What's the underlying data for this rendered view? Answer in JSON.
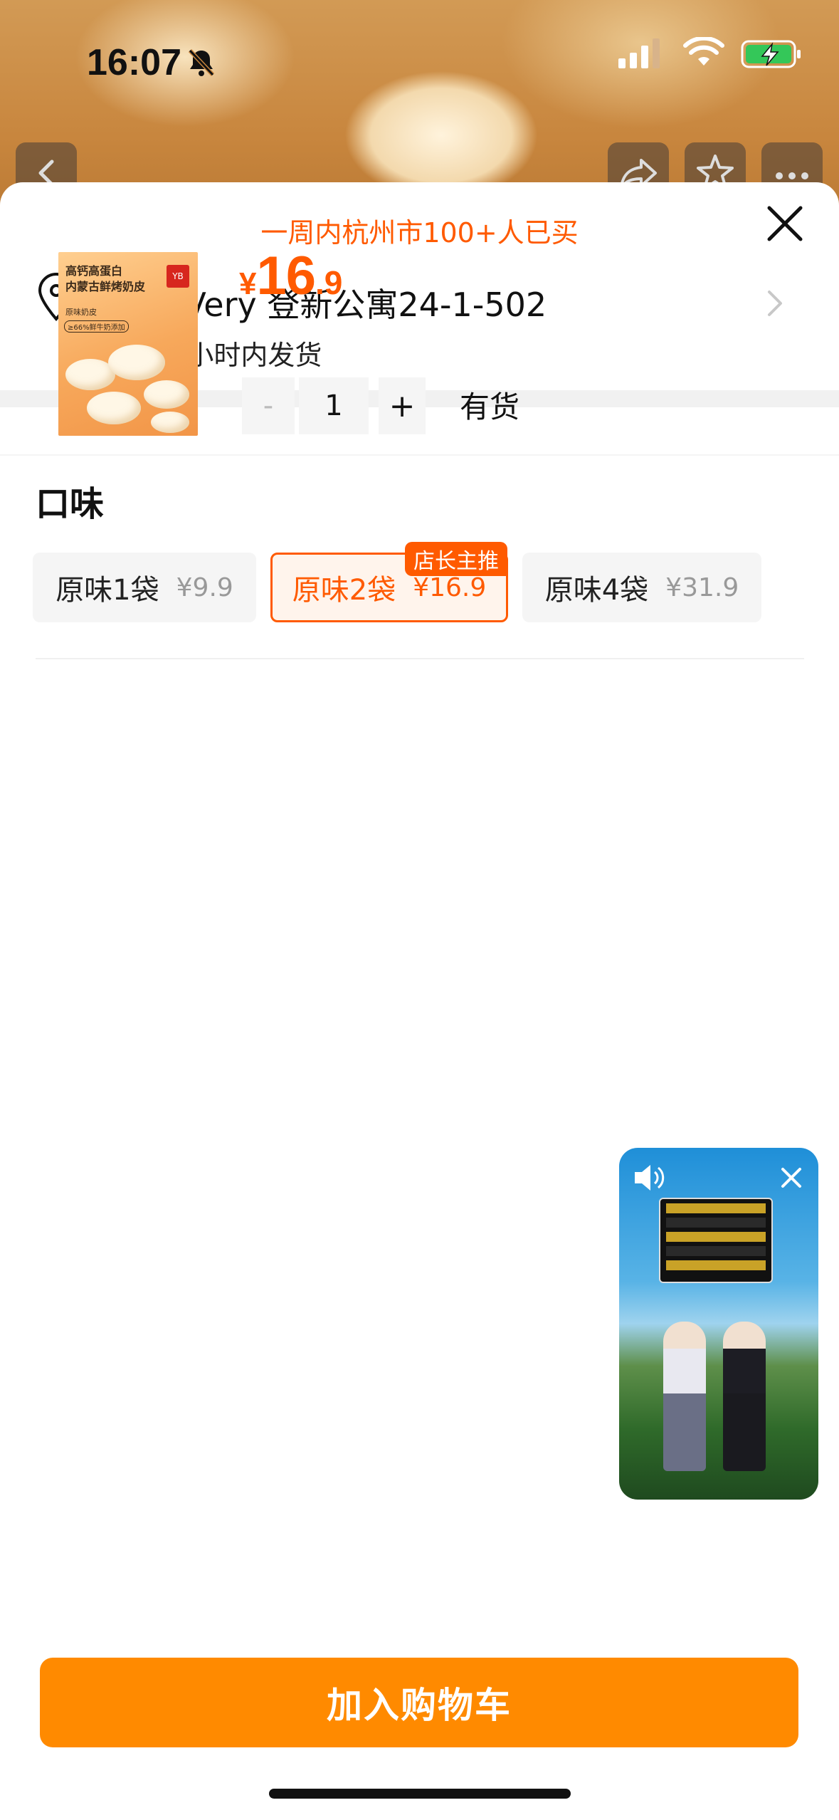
{
  "status_bar": {
    "time": "16:07",
    "icons": [
      "bell-off-icon",
      "signal-icon",
      "wifi-icon",
      "battery-charging-icon"
    ]
  },
  "header": {
    "buttons": [
      "back-icon",
      "share-icon",
      "star-icon",
      "more-icon"
    ]
  },
  "sheet": {
    "buyers_text": "一周内杭州市100+人已买",
    "address": "ChingVery 登新公寓24-1-502",
    "shipping": "包邮 48小时内发货",
    "product_image_text": {
      "title_line1": "高钙高蛋白",
      "title_line2": "内蒙古鲜烤奶皮",
      "tag1": "原味奶皮",
      "tag2": "≥66%鲜牛奶添加"
    },
    "price": {
      "currency": "¥",
      "integer": "16",
      "decimal": ".9"
    },
    "quantity": {
      "minus": "-",
      "value": "1",
      "plus": "+"
    },
    "stock": "有货",
    "flavor_label": "口味",
    "options": [
      {
        "name": "原味1袋",
        "price": "¥9.9",
        "selected": false
      },
      {
        "name": "原味2袋",
        "price": "¥16.9",
        "selected": true,
        "badge": "店长主推"
      },
      {
        "name": "原味4袋",
        "price": "¥31.9",
        "selected": false
      }
    ],
    "add_to_cart": "加入购物车"
  },
  "colors": {
    "accent": "#ff5a00",
    "cart_button": "#ff8a00"
  }
}
